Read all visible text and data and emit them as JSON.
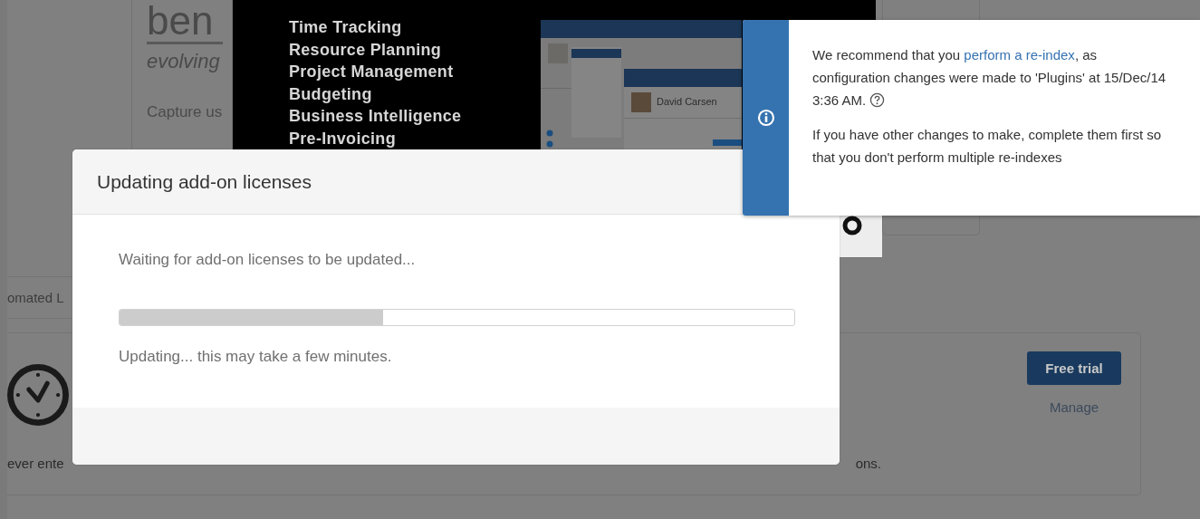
{
  "page": {
    "logo": {
      "wordmark": "ben",
      "tagline": "evolving"
    },
    "intro": "Capture us",
    "banner": {
      "features": [
        "Time Tracking",
        "Resource Planning",
        "Project Management",
        "Budgeting",
        "Business Intelligence",
        "Pre-Invoicing"
      ],
      "inset": {
        "user_name": "David Carsen"
      }
    },
    "tab": "omated L",
    "addon": {
      "description_start": "ever ente",
      "description_end": "ons.",
      "actions": [
        {
          "label": "Free trial",
          "kind": "primary"
        },
        {
          "label": "Manage",
          "kind": "link"
        }
      ]
    }
  },
  "modal": {
    "title": "Updating add-on licenses",
    "message": "Waiting for add-on licenses to be updated...",
    "progress": {
      "level": 0.39
    },
    "status": "Updating... this may take a few minutes."
  },
  "flag": {
    "paragraphs": [
      [
        {
          "text": "We recommend that you "
        },
        {
          "text": "perform a re-index",
          "kind": "link"
        },
        {
          "text": ", as configuration changes were made to 'Plugins' at 15/Dec/14 3:36 AM. "
        },
        {
          "kind": "help"
        }
      ],
      [
        {
          "text": "If you have other changes to make, complete them first so that you don't perform multiple re-indexes"
        }
      ]
    ]
  }
}
